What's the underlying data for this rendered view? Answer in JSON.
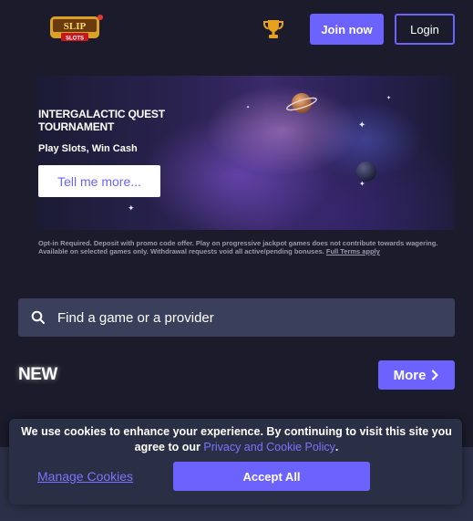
{
  "header": {
    "logo": {
      "text_top": "SLIP",
      "text_bottom": "SLOTS",
      "icon": "slot-machine-logo"
    },
    "trophy_icon": "trophy-icon",
    "join_label": "Join now",
    "login_label": "Login"
  },
  "banner": {
    "title": "INTERGALACTIC QUEST TOURNAMENT",
    "subtitle": "Play Slots, Win Cash",
    "cta_label": "Tell me more..."
  },
  "terms": {
    "text": "Opt-in Required. Deposit with promo code offer. Play on progressive jackpot games does not contribute towards wagering. Available on selected games only. Withdrawal requests void all active/pending bonuses. ",
    "link": "Full Terms apply"
  },
  "search": {
    "placeholder": "Find a game or a provider",
    "icon": "search-icon"
  },
  "new_section": {
    "title": "NEW",
    "more_label": "More"
  },
  "cookie": {
    "text_before": "We use cookies to enhance your experience. By continuing to visit this site you agree to our ",
    "link": "Privacy and Cookie Policy",
    "text_after": ".",
    "manage_label": "Manage Cookies",
    "accept_label": "Accept All"
  },
  "colors": {
    "background": "#1b1b2b",
    "accent": "#6c63ff",
    "search_bg": "#3a3f5c",
    "cookie_bg": "#2b2f45"
  }
}
